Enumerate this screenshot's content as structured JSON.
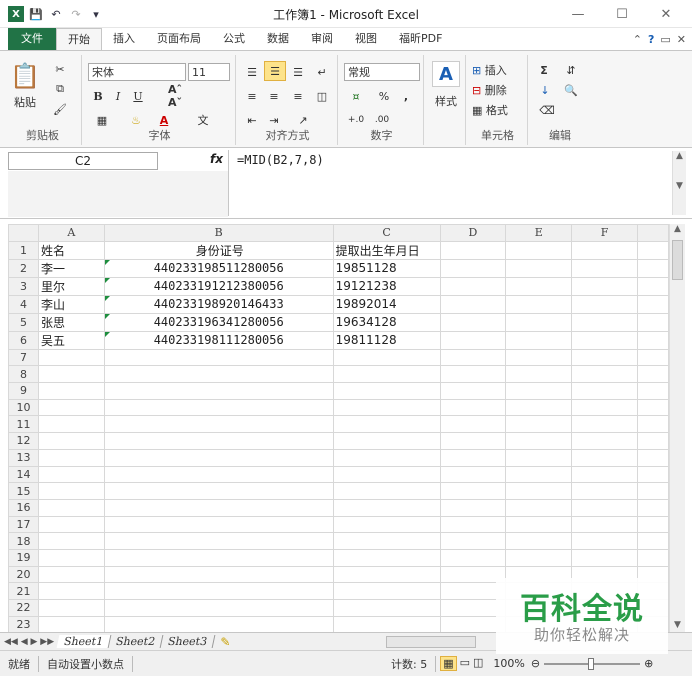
{
  "window": {
    "title": "工作簿1 - Microsoft Excel"
  },
  "tabs": [
    "文件",
    "开始",
    "插入",
    "页面布局",
    "公式",
    "数据",
    "审阅",
    "视图",
    "福昕PDF"
  ],
  "ribbon": {
    "clipboard": {
      "paste": "粘贴",
      "label": "剪贴板"
    },
    "font": {
      "name": "宋体",
      "size": "11",
      "label": "字体",
      "bold": "B",
      "italic": "I",
      "underline": "U"
    },
    "alignment": {
      "label": "对齐方式"
    },
    "number": {
      "format": "常规",
      "label": "数字",
      "percent": "%",
      "comma": ","
    },
    "styles": {
      "label": "样式"
    },
    "cells": {
      "insert": "插入",
      "delete": "删除",
      "format": "格式",
      "label": "单元格"
    },
    "editing": {
      "label": "编辑",
      "sum": "Σ"
    }
  },
  "formula_bar": {
    "name_box": "C2",
    "fx": "fx",
    "formula": "=MID(B2,7,8)"
  },
  "columns": [
    "A",
    "B",
    "C",
    "D",
    "E",
    "F"
  ],
  "rows": [
    {
      "n": "1",
      "a": "姓名",
      "b": "身份证号",
      "c": "提取出生年月日"
    },
    {
      "n": "2",
      "a": "李一",
      "b": "440233198511280056",
      "c": "19851128"
    },
    {
      "n": "3",
      "a": "里尔",
      "b": "440233191212380056",
      "c": "19121238"
    },
    {
      "n": "4",
      "a": "李山",
      "b": "440233198920146433",
      "c": "19892014"
    },
    {
      "n": "5",
      "a": "张思",
      "b": "440233196341280056",
      "c": "19634128"
    },
    {
      "n": "6",
      "a": "吴五",
      "b": "440233198111280056",
      "c": "19811128"
    },
    {
      "n": "7",
      "a": "",
      "b": "",
      "c": ""
    },
    {
      "n": "8",
      "a": "",
      "b": "",
      "c": ""
    },
    {
      "n": "9",
      "a": "",
      "b": "",
      "c": ""
    },
    {
      "n": "10",
      "a": "",
      "b": "",
      "c": ""
    },
    {
      "n": "11",
      "a": "",
      "b": "",
      "c": ""
    },
    {
      "n": "12",
      "a": "",
      "b": "",
      "c": ""
    },
    {
      "n": "13",
      "a": "",
      "b": "",
      "c": ""
    },
    {
      "n": "14",
      "a": "",
      "b": "",
      "c": ""
    },
    {
      "n": "15",
      "a": "",
      "b": "",
      "c": ""
    },
    {
      "n": "16",
      "a": "",
      "b": "",
      "c": ""
    },
    {
      "n": "17",
      "a": "",
      "b": "",
      "c": ""
    },
    {
      "n": "18",
      "a": "",
      "b": "",
      "c": ""
    },
    {
      "n": "19",
      "a": "",
      "b": "",
      "c": ""
    },
    {
      "n": "20",
      "a": "",
      "b": "",
      "c": ""
    },
    {
      "n": "21",
      "a": "",
      "b": "",
      "c": ""
    },
    {
      "n": "22",
      "a": "",
      "b": "",
      "c": ""
    },
    {
      "n": "23",
      "a": "",
      "b": "",
      "c": ""
    }
  ],
  "sheets": [
    "Sheet1",
    "Sheet2",
    "Sheet3"
  ],
  "status": {
    "ready": "就绪",
    "auto_decimal": "自动设置小数点",
    "count": "计数: 5",
    "zoom": "100%"
  },
  "watermark": {
    "title": "百科全说",
    "subtitle": "助你轻松解决"
  },
  "colors": {
    "file_tab": "#217346",
    "watermark": "#2a9d48"
  }
}
